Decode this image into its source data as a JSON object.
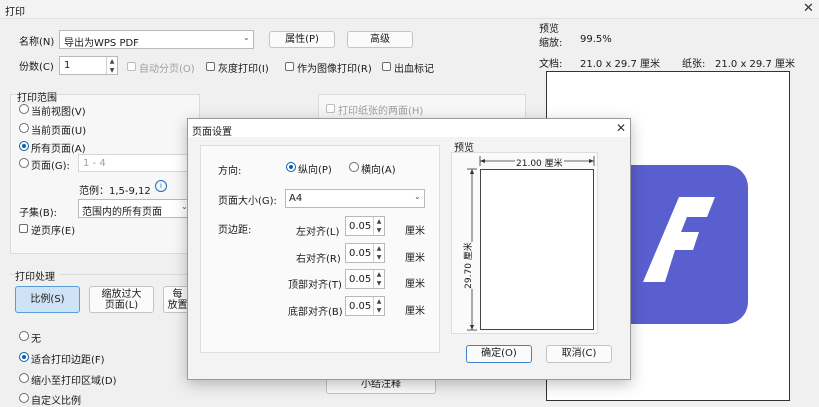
{
  "window": {
    "title": "打印",
    "close_icon": "close-icon"
  },
  "main": {
    "name_label": "名称(N)",
    "printer_value": "导出为WPS PDF",
    "properties_button": "属性(P)",
    "advanced_button": "高级",
    "copies_label": "份数(C)",
    "copies_value": "1",
    "collate_label": "自动分页(O)",
    "grayscale_label": "灰度打印(I)",
    "print_as_image_label": "作为图像打印(R)",
    "bleed_label": "出血标记",
    "duplex_label": "打印纸张的两面(H)",
    "range_title": "打印范围",
    "range_current_view": "当前视图(V)",
    "range_current_page": "当前页面(U)",
    "range_all_pages": "所有页面(A)",
    "range_pages": "页面(G):",
    "pages_placeholder": "1 - 4",
    "example_text": "范例：1,5-9,12",
    "subset_label": "子集(B):",
    "subset_value": "范围内的所有页面",
    "reverse_label": "逆页序(E)",
    "handling_title": "打印处理",
    "scale_button": "比例(S)",
    "shrink_button_line1": "缩放过大",
    "shrink_button_line2": "页面(L)",
    "fit_button_partial_1": "每",
    "fit_button_partial_2": "放置",
    "opt_none": "无",
    "opt_fit_margins": "适合打印边距(F)",
    "opt_shrink_area": "缩小至打印区域(D)",
    "opt_custom_partial": "自定义比例",
    "summary_button": "小结注释"
  },
  "preview": {
    "title": "预览",
    "zoom_label": "缩放:",
    "zoom_value": "99.5%",
    "doc_label": "文档:",
    "doc_value": "21.0 x 29.7 厘米",
    "paper_label": "纸张:",
    "paper_value": "21.0 x 29.7 厘米",
    "logo_color": "#5a5fcf"
  },
  "dialog": {
    "title": "页面设置",
    "orientation_label": "方向:",
    "portrait_label": "纵向(P)",
    "landscape_label": "横向(A)",
    "paper_size_label": "页面大小(G):",
    "paper_size_value": "A4",
    "margins_label": "页边距:",
    "left_label": "左对齐(L)",
    "left_value": "0.05",
    "right_label": "右对齐(R)",
    "right_value": "0.05",
    "top_label": "顶部对齐(T)",
    "top_value": "0.05",
    "bottom_label": "底部对齐(B)",
    "bottom_value": "0.05",
    "unit": "厘米",
    "preview_title": "预览",
    "width_dim": "21.00 厘米",
    "height_dim": "29.70 厘米",
    "ok_button": "确定(O)",
    "cancel_button": "取消(C)"
  }
}
